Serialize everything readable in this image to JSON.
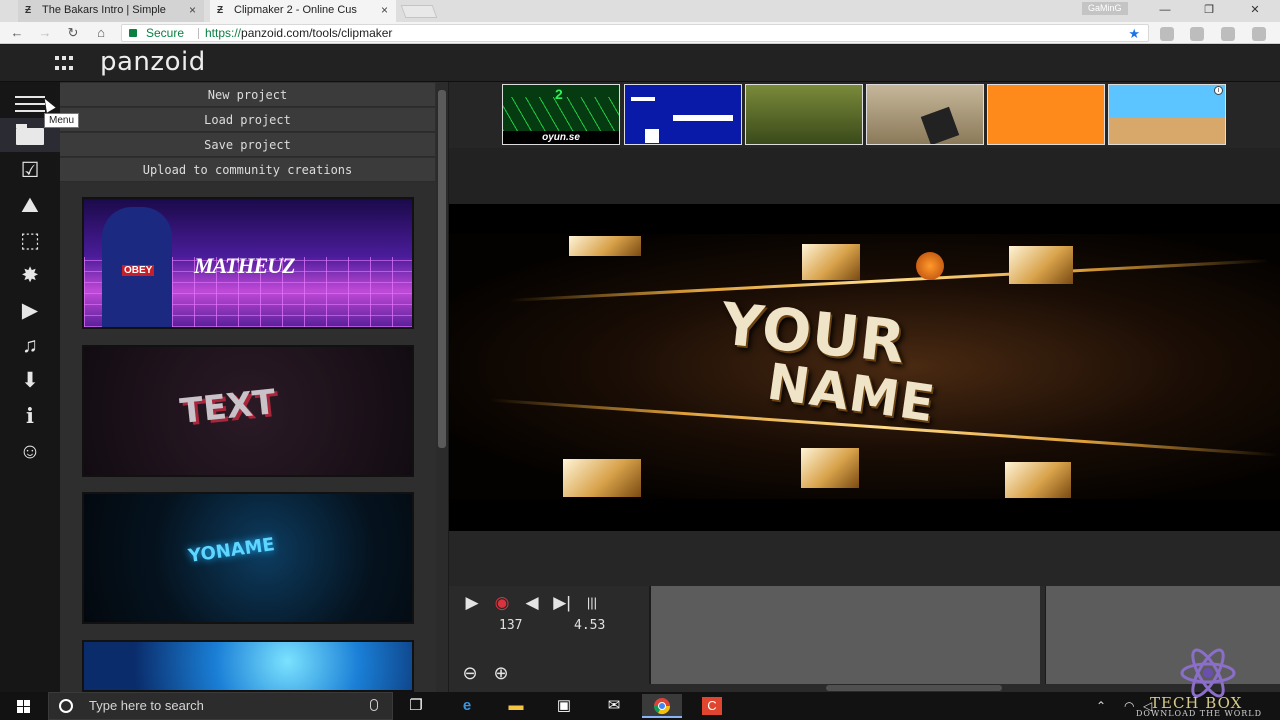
{
  "browser": {
    "tabs": [
      {
        "title": "The Bakars Intro | Simple",
        "active": false
      },
      {
        "title": "Clipmaker 2 - Online Cus",
        "active": true
      }
    ],
    "tab_close": "×",
    "profile_name": "GaMinG",
    "secure_label": "Secure",
    "url_protocol": "https://",
    "url_rest": "panzoid.com/tools/clipmaker",
    "window_controls": {
      "minimize": "—",
      "maximize": "❐",
      "close": "✕"
    }
  },
  "app": {
    "logo": "panzoid",
    "menu_tooltip": "Menu"
  },
  "sidebar": {
    "icons": [
      {
        "name": "menu-icon",
        "glyph": ""
      },
      {
        "name": "folder-icon",
        "glyph": ""
      },
      {
        "name": "checkbox-icon",
        "glyph": "☑"
      },
      {
        "name": "landscape-icon",
        "glyph": "⛰"
      },
      {
        "name": "cube-icon",
        "glyph": "⬚"
      },
      {
        "name": "burst-icon",
        "glyph": "✸"
      },
      {
        "name": "video-camera-icon",
        "glyph": "▶"
      },
      {
        "name": "music-note-icon",
        "glyph": "♫"
      },
      {
        "name": "download-icon",
        "glyph": "⬇"
      },
      {
        "name": "info-icon",
        "glyph": "ℹ"
      },
      {
        "name": "smiley-icon",
        "glyph": "☺"
      }
    ]
  },
  "menu": {
    "items": [
      "New project",
      "Load project",
      "Save project",
      "Upload to community creations"
    ]
  },
  "thumbnails": [
    {
      "text": "OBEY",
      "signature": "MATHEUZ"
    },
    {
      "text": "TEXT"
    },
    {
      "text": "YONAME"
    },
    {
      "text": ""
    }
  ],
  "templates": [
    {
      "caption": "oyun.se",
      "number": "2"
    },
    {
      "caption": ""
    },
    {
      "caption": ""
    },
    {
      "caption": ""
    },
    {
      "caption": ""
    },
    {
      "caption": "",
      "info": "i"
    }
  ],
  "preview": {
    "line1": "YOUR",
    "line2": "NAME"
  },
  "controls": {
    "play": "▶",
    "record": "◉",
    "back": "◀",
    "step": "▶|",
    "audio": "|||",
    "frame": "137",
    "time": "4.53",
    "zoom_out": "⊖",
    "zoom_in": "⊕"
  },
  "taskbar": {
    "search_placeholder": "Type here to search"
  },
  "watermark": {
    "title": "TECH BOX",
    "subtitle": "DOWNLOAD THE WORLD"
  }
}
